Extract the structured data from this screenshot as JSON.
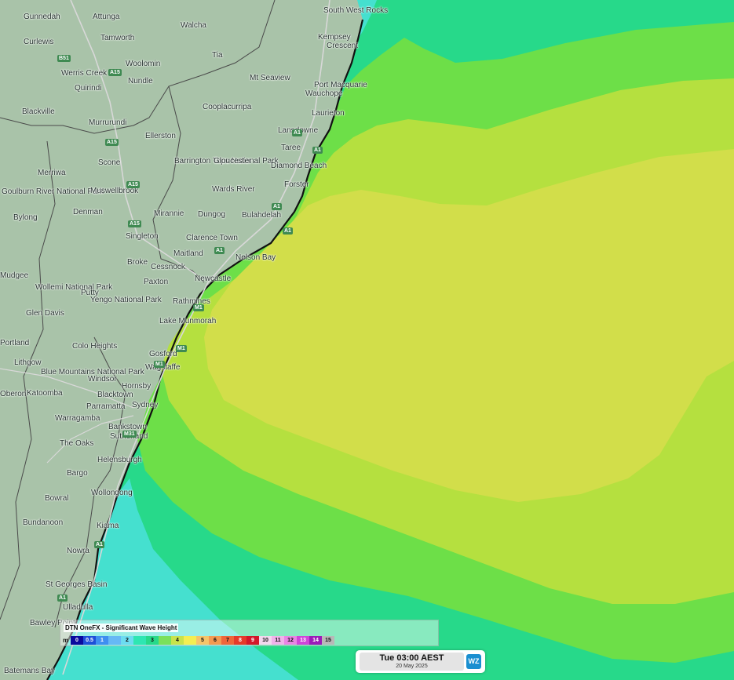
{
  "map": {
    "labels": [
      {
        "text": "Gunnedah",
        "name": "gunnedah"
      },
      {
        "text": "Attunga",
        "name": "attunga"
      },
      {
        "text": "Walcha",
        "name": "walcha"
      },
      {
        "text": "South West Rocks",
        "name": "south-west-rocks"
      },
      {
        "text": "Curlewis",
        "name": "curlewis"
      },
      {
        "text": "Tamworth",
        "name": "tamworth"
      },
      {
        "text": "Kempsey",
        "name": "kempsey"
      },
      {
        "text": "Crescent",
        "name": "crescent-head"
      },
      {
        "text": "Woolomin",
        "name": "woolomin"
      },
      {
        "text": "Tia",
        "name": "tia"
      },
      {
        "text": "Werris Creek",
        "name": "werris-creek"
      },
      {
        "text": "Quirindi",
        "name": "quirindi"
      },
      {
        "text": "Nundle",
        "name": "nundle"
      },
      {
        "text": "Mt Seaview",
        "name": "mt-seaview"
      },
      {
        "text": "Port Macquarie",
        "name": "port-macquarie"
      },
      {
        "text": "Wauchope",
        "name": "wauchope"
      },
      {
        "text": "Blackville",
        "name": "blackville"
      },
      {
        "text": "Cooplacurripa",
        "name": "cooplacurripa"
      },
      {
        "text": "Laurieton",
        "name": "laurieton"
      },
      {
        "text": "Murrurundi",
        "name": "murrurundi"
      },
      {
        "text": "Lansdowne",
        "name": "lansdowne"
      },
      {
        "text": "Taree",
        "name": "taree"
      },
      {
        "text": "Ellerston",
        "name": "ellerston"
      },
      {
        "text": "Barrington Tops National Park",
        "name": "barrington-tops"
      },
      {
        "text": "Gloucester",
        "name": "gloucester"
      },
      {
        "text": "Diamond Beach",
        "name": "diamond-beach"
      },
      {
        "text": "Scone",
        "name": "scone"
      },
      {
        "text": "Merriwa",
        "name": "merriwa"
      },
      {
        "text": "Forster",
        "name": "forster"
      },
      {
        "text": "Wards River",
        "name": "wards-river"
      },
      {
        "text": "Goulburn River National Park",
        "name": "goulburn-river"
      },
      {
        "text": "Muswellbrook",
        "name": "muswellbrook"
      },
      {
        "text": "Denman",
        "name": "denman"
      },
      {
        "text": "Mirannie",
        "name": "mirannie"
      },
      {
        "text": "Dungog",
        "name": "dungog"
      },
      {
        "text": "Bulahdelah",
        "name": "bulahdelah"
      },
      {
        "text": "Bylong",
        "name": "bylong"
      },
      {
        "text": "Singleton",
        "name": "singleton"
      },
      {
        "text": "Clarence Town",
        "name": "clarence-town"
      },
      {
        "text": "Maitland",
        "name": "maitland"
      },
      {
        "text": "Nelson Bay",
        "name": "nelson-bay"
      },
      {
        "text": "Broke",
        "name": "broke"
      },
      {
        "text": "Cessnock",
        "name": "cessnock"
      },
      {
        "text": "Paxton",
        "name": "paxton"
      },
      {
        "text": "Newcastle",
        "name": "newcastle"
      },
      {
        "text": "Wollemi National Park",
        "name": "wollemi"
      },
      {
        "text": "Putty",
        "name": "putty"
      },
      {
        "text": "Yengo National Park",
        "name": "yengo"
      },
      {
        "text": "Rathmines",
        "name": "rathmines"
      },
      {
        "text": "Glen Davis",
        "name": "glen-davis"
      },
      {
        "text": "Lake Munmorah",
        "name": "lake-munmorah"
      },
      {
        "text": "Colo Heights",
        "name": "colo-heights"
      },
      {
        "text": "Gosford",
        "name": "gosford"
      },
      {
        "text": "Lithgow",
        "name": "lithgow"
      },
      {
        "text": "Wagstaffe",
        "name": "wagstaffe"
      },
      {
        "text": "Blue Mountains National Park",
        "name": "blue-mountains"
      },
      {
        "text": "Windsor",
        "name": "windsor"
      },
      {
        "text": "Hornsby",
        "name": "hornsby"
      },
      {
        "text": "Katoomba",
        "name": "katoomba"
      },
      {
        "text": "Blacktown",
        "name": "blacktown"
      },
      {
        "text": "Parramatta",
        "name": "parramatta"
      },
      {
        "text": "Sydney",
        "name": "sydney"
      },
      {
        "text": "Warragamba",
        "name": "warragamba"
      },
      {
        "text": "Bankstown",
        "name": "bankstown"
      },
      {
        "text": "The Oaks",
        "name": "the-oaks"
      },
      {
        "text": "Sutherland",
        "name": "sutherland"
      },
      {
        "text": "Helensburgh",
        "name": "helensburgh"
      },
      {
        "text": "Bargo",
        "name": "bargo"
      },
      {
        "text": "Wollongong",
        "name": "wollongong"
      },
      {
        "text": "Bowral",
        "name": "bowral"
      },
      {
        "text": "Bundanoon",
        "name": "bundanoon"
      },
      {
        "text": "Kiama",
        "name": "kiama"
      },
      {
        "text": "Nowra",
        "name": "nowra"
      },
      {
        "text": "St Georges Basin",
        "name": "st-georges-basin"
      },
      {
        "text": "Ulladulla",
        "name": "ulladulla"
      },
      {
        "text": "Bawley Point",
        "name": "bawley-point"
      },
      {
        "text": "Batemans Bay",
        "name": "batemans-bay"
      },
      {
        "text": "Oberon",
        "name": "oberon"
      },
      {
        "text": "Portland",
        "name": "portland"
      },
      {
        "text": "Mudgee",
        "name": "mudgee"
      }
    ],
    "roads": [
      "B51",
      "A15",
      "A15",
      "A15",
      "A15",
      "A1",
      "A1",
      "A1",
      "A1",
      "A1",
      "M1",
      "M1",
      "M1",
      "M31",
      "A1",
      "A1"
    ]
  },
  "legend": {
    "title": "DTN OneFX - Significant Wave Height",
    "unit": "m",
    "swatches": [
      {
        "label": "0",
        "color": "#0a0a9e"
      },
      {
        "label": "0.5",
        "color": "#1e4fd8"
      },
      {
        "label": "1",
        "color": "#3f8ff0"
      },
      {
        "label": "",
        "color": "#66b8f5"
      },
      {
        "label": "2",
        "color": "#6cdcf0"
      },
      {
        "label": "",
        "color": "#2ee6b2"
      },
      {
        "label": "3",
        "color": "#27d98a"
      },
      {
        "label": "",
        "color": "#7be05a"
      },
      {
        "label": "4",
        "color": "#c9e34b"
      },
      {
        "label": "",
        "color": "#f4ee52"
      },
      {
        "label": "5",
        "color": "#f6c46a"
      },
      {
        "label": "6",
        "color": "#f39a52"
      },
      {
        "label": "7",
        "color": "#f0663a"
      },
      {
        "label": "8",
        "color": "#e63a2a"
      },
      {
        "label": "9",
        "color": "#d3192a"
      },
      {
        "label": "10",
        "color": "#f3d8ee"
      },
      {
        "label": "11",
        "color": "#f0b3ea"
      },
      {
        "label": "12",
        "color": "#ea85e4"
      },
      {
        "label": "13",
        "color": "#cf45d9"
      },
      {
        "label": "14",
        "color": "#9b1cb8"
      },
      {
        "label": "15",
        "color": "#b8b8b8"
      }
    ]
  },
  "timestamp": {
    "time": "Tue 03:00 AEST",
    "date": "20 May 2025",
    "logo": "WZ"
  },
  "colors": {
    "land": "#a9c3a9",
    "wave_2m": "#6cdcf0",
    "wave_3m": "#27d98a",
    "wave_3_5m": "#7be05a",
    "wave_4m": "#b7e045",
    "wave_4_5m": "#d3de4c"
  }
}
